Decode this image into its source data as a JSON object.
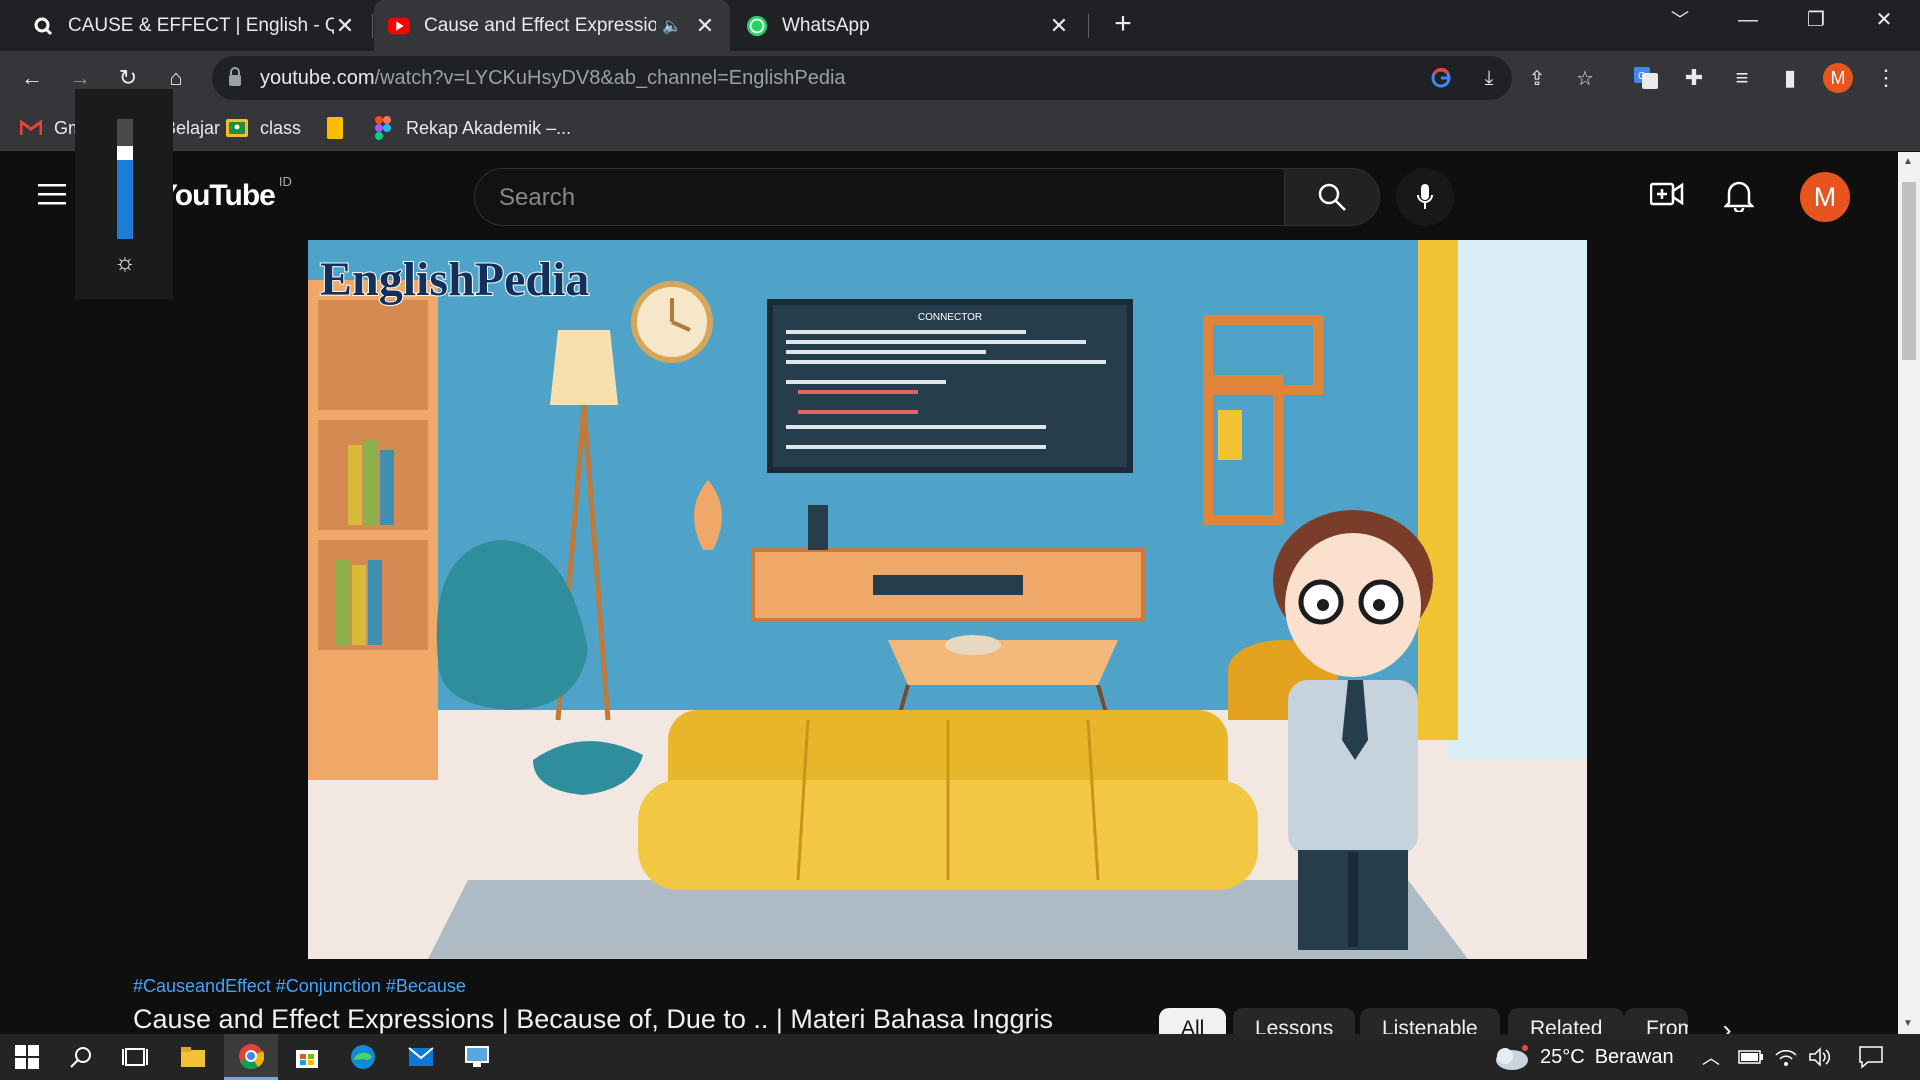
{
  "browser": {
    "tabs": [
      {
        "title": "CAUSE & EFFECT | English - Quizi"
      },
      {
        "title": "Cause and Effect Expressions"
      },
      {
        "title": "WhatsApp"
      }
    ],
    "new_tab": "+",
    "url_host": "youtube.com",
    "url_path": "/watch?v=LYCKuHsyDV8&ab_channel=EnglishPedia",
    "profile_letter": "M"
  },
  "bookmarks": [
    {
      "label": "Gmail"
    },
    {
      "label": "Belajar"
    },
    {
      "label": "class"
    },
    {
      "label": ""
    },
    {
      "label": "Rekap Akademik –..."
    }
  ],
  "youtube": {
    "logo_text": "YouTube",
    "region": "ID",
    "search_placeholder": "Search",
    "avatar_letter": "M"
  },
  "video": {
    "brand": "EnglishPedia",
    "board_title": "CONNECTOR"
  },
  "below_video": {
    "hashtags": "#CauseandEffect #Conjunction #Because",
    "title": "Cause and Effect Expressions | Because of, Due to .. | Materi Bahasa Inggris"
  },
  "chips": [
    "All",
    "Lessons",
    "Listenable",
    "Related",
    "From"
  ],
  "brightness": {
    "level": 0.72
  },
  "taskbar": {
    "weather_temp": "25°C",
    "weather_text": "Berawan"
  },
  "colors": {
    "youtube_red": "#ff0000",
    "avatar": "#e8541e",
    "link_blue": "#3ea6ff"
  }
}
